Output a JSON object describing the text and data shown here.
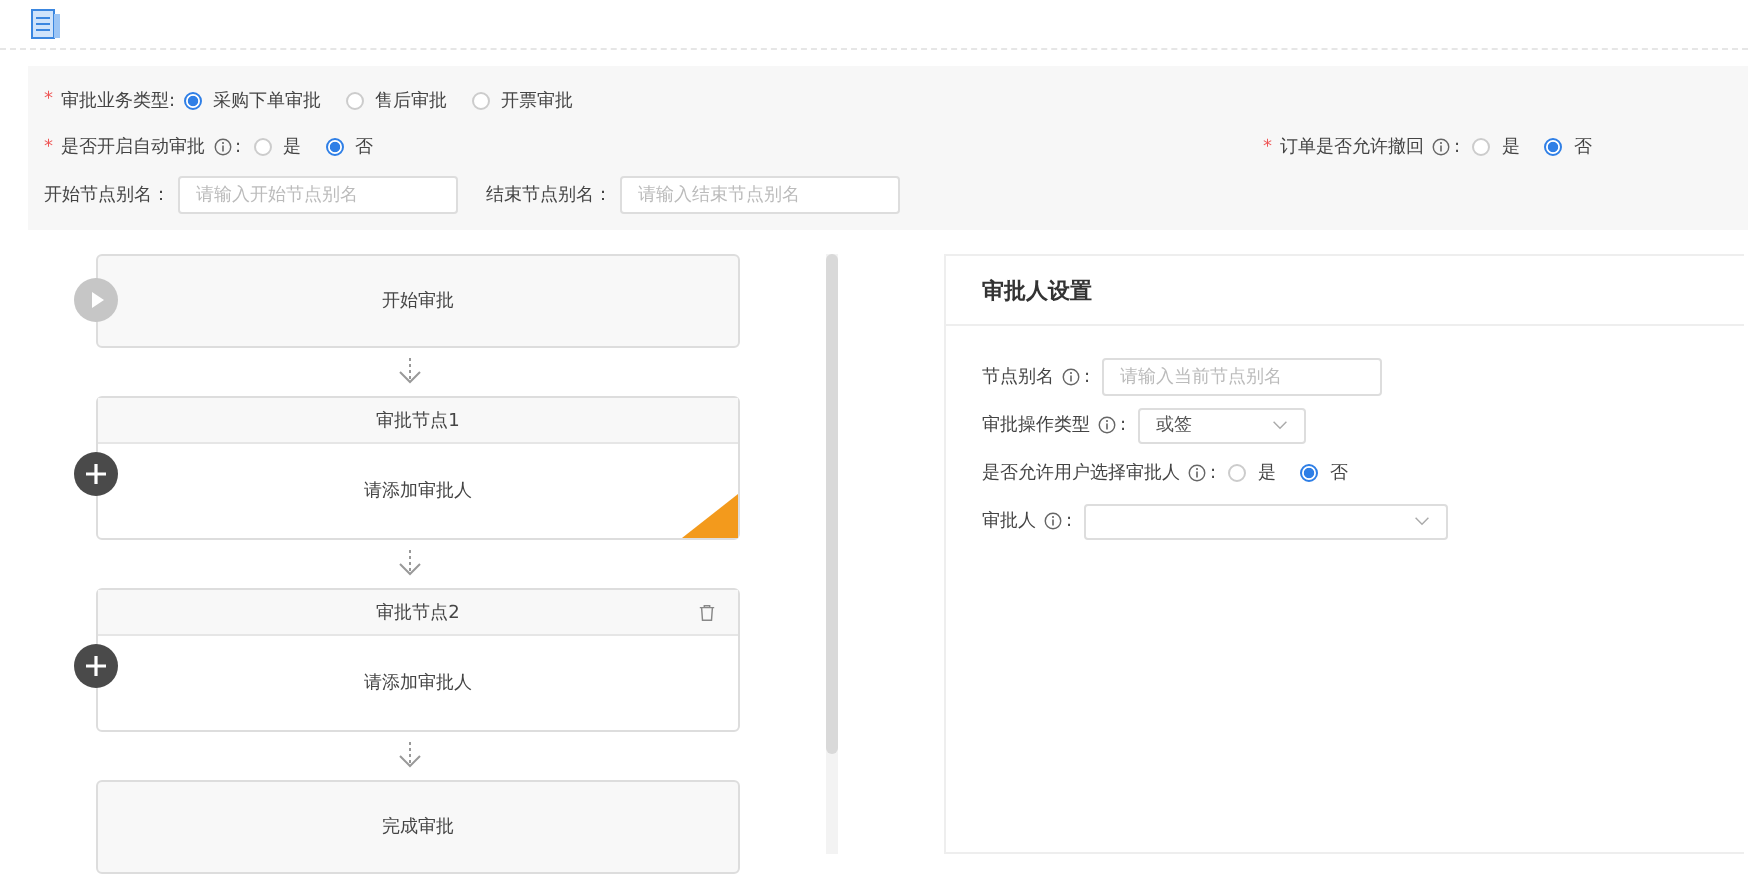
{
  "form": {
    "business_type": {
      "label": "审批业务类型:",
      "required_mark": "*",
      "options": [
        {
          "label": "采购下单审批",
          "selected": true
        },
        {
          "label": "售后审批",
          "selected": false
        },
        {
          "label": "开票审批",
          "selected": false
        }
      ]
    },
    "auto_approve": {
      "label": "是否开启自动审批",
      "suffix": ":",
      "required_mark": "*",
      "options": [
        {
          "label": "是",
          "selected": false
        },
        {
          "label": "否",
          "selected": true
        }
      ]
    },
    "order_recall": {
      "label": "订单是否允许撤回",
      "suffix": ":",
      "required_mark": "*",
      "options": [
        {
          "label": "是",
          "selected": false
        },
        {
          "label": "否",
          "selected": true
        }
      ]
    },
    "start_alias": {
      "label": "开始节点别名：",
      "placeholder": "请输入开始节点别名"
    },
    "end_alias": {
      "label": "结束节点别名：",
      "placeholder": "请输入结束节点别名"
    }
  },
  "flow": [
    {
      "kind": "start",
      "label": "开始审批"
    },
    {
      "kind": "approval",
      "title": "审批节点1",
      "body": "请添加审批人",
      "tagged": true,
      "deletable": false
    },
    {
      "kind": "approval",
      "title": "审批节点2",
      "body": "请添加审批人",
      "tagged": false,
      "deletable": true
    },
    {
      "kind": "end",
      "label": "完成审批"
    }
  ],
  "settings": {
    "title": "审批人设置",
    "fields": [
      {
        "kind": "input",
        "label": "节点别名",
        "suffix": ":",
        "placeholder": "请输入当前节点别名"
      },
      {
        "kind": "select",
        "label": "审批操作类型",
        "suffix": ":",
        "value": "或签"
      },
      {
        "kind": "radio",
        "label": "是否允许用户选择审批人",
        "suffix": ":",
        "options": [
          {
            "label": "是",
            "selected": false
          },
          {
            "label": "否",
            "selected": true
          }
        ]
      },
      {
        "kind": "select",
        "label": "审批人",
        "suffix": ":"
      }
    ]
  }
}
